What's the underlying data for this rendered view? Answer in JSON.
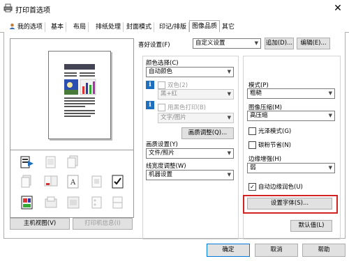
{
  "window": {
    "title": "打印首选项",
    "close_icon": "close-icon"
  },
  "tabs": [
    "我的选项",
    "基本",
    "布局",
    "排纸处理",
    "封面模式",
    "印记/排版",
    "图像品质",
    "其它"
  ],
  "favorites": {
    "label": "喜好设置(F)",
    "value": "自定义设置",
    "add_button": "追加(D)...",
    "edit_button": "编辑(E)..."
  },
  "left": {
    "main_view_button": "主机视图(V)",
    "printer_info_button": "打印机信息(I)"
  },
  "color": {
    "label": "颜色选择(C)",
    "value": "自动颜色",
    "dual_label": "双色(2)",
    "dual_value": "黑+红",
    "black_print_label": "用黑色打印(B)",
    "black_print_value": "文字/图片",
    "quality_button": "画质调整(Q)..."
  },
  "image_settings": {
    "label": "画质设置(Y)",
    "value": "文件/照片"
  },
  "line_width": {
    "label": "线宽度调整(W)",
    "value": "机器设置"
  },
  "mode": {
    "label": "模式(P)",
    "value": "粗糙"
  },
  "compression": {
    "label": "图像压缩(M)",
    "value": "高压缩"
  },
  "gloss_label": "光泽模式(G)",
  "toner_label": "碳粉节省(N)",
  "edge": {
    "label": "边缘增强(H)",
    "value": "弱"
  },
  "auto_trap_label": "自动边缘润色(U)",
  "font_button": "设置字体(S)...",
  "default_button": "默认值(L)",
  "footer": {
    "ok": "确定",
    "cancel": "取消",
    "help": "帮助"
  }
}
